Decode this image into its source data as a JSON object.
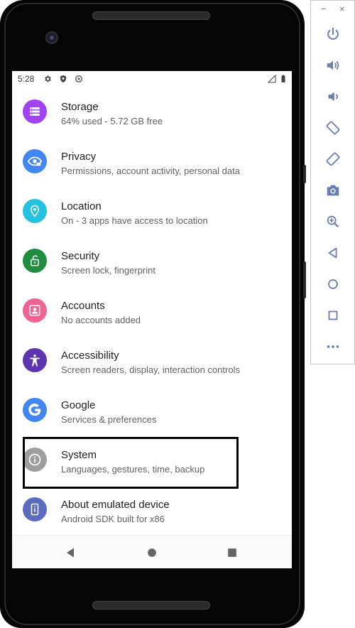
{
  "status_bar": {
    "time": "5:28",
    "icons": [
      "gear-icon",
      "shield-icon",
      "data-saver-icon"
    ],
    "right_icons": [
      "signal-icon",
      "battery-icon"
    ]
  },
  "settings_items": [
    {
      "title": "Storage",
      "subtitle": "64% used - 5.72 GB free",
      "icon": "storage-icon",
      "color": "#A142F4"
    },
    {
      "title": "Privacy",
      "subtitle": "Permissions, account activity, personal data",
      "icon": "privacy-icon",
      "color": "#4285F4"
    },
    {
      "title": "Location",
      "subtitle": "On - 3 apps have access to location",
      "icon": "location-icon",
      "color": "#24C1E0"
    },
    {
      "title": "Security",
      "subtitle": "Screen lock, fingerprint",
      "icon": "lock-icon",
      "color": "#1E8E3E"
    },
    {
      "title": "Accounts",
      "subtitle": "No accounts added",
      "icon": "account-icon",
      "color": "#F06292"
    },
    {
      "title": "Accessibility",
      "subtitle": "Screen readers, display, interaction controls",
      "icon": "accessibility-icon",
      "color": "#5E35B1"
    },
    {
      "title": "Google",
      "subtitle": "Services & preferences",
      "icon": "google-icon",
      "color": "#4285F4"
    },
    {
      "title": "System",
      "subtitle": "Languages, gestures, time, backup",
      "icon": "info-icon",
      "color": "#9E9E9E"
    },
    {
      "title": "About emulated device",
      "subtitle": "Android SDK built for x86",
      "icon": "device-info-icon",
      "color": "#5C6BC0"
    }
  ],
  "nav_bar": [
    "back-icon",
    "home-icon",
    "recents-icon"
  ],
  "emulator_panel": {
    "window_controls": [
      "−",
      "×"
    ],
    "buttons": [
      "power-icon",
      "volume-up-icon",
      "volume-down-icon",
      "rotate-left-icon",
      "rotate-right-icon",
      "camera-icon",
      "zoom-icon",
      "back-icon",
      "home-icon",
      "overview-icon",
      "more-icon"
    ]
  }
}
